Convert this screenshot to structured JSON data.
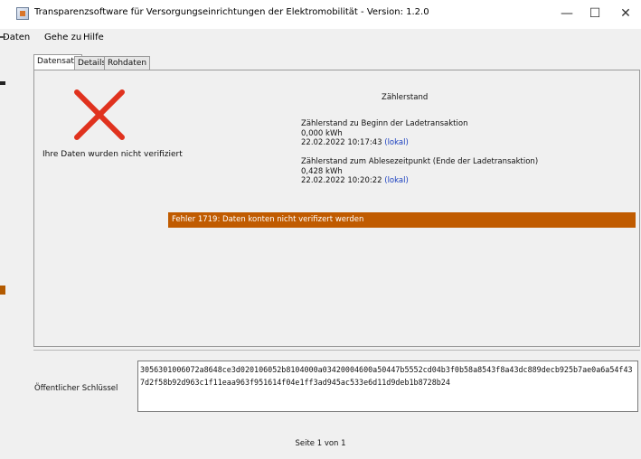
{
  "window": {
    "title": "Transparenzsoftware für Versorgungseinrichtungen der Elektromobilität - Version: 1.2.0",
    "controls": {
      "minimize": "—",
      "maximize": "☐",
      "close": "✕"
    }
  },
  "menu": {
    "items": [
      "Daten",
      "Gehe zu",
      "Hilfe"
    ]
  },
  "tabs": [
    "Datensatz",
    "Details",
    "Rohdaten"
  ],
  "status": {
    "message": "Ihre Daten wurden nicht verifiziert",
    "icon": "red-x-icon",
    "color": "#e0321e"
  },
  "meter": {
    "title": "Zählerstand",
    "start": {
      "label": "Zählerstand zu Beginn der Ladetransaktion",
      "value": "0,000 kWh",
      "timestamp": "22.02.2022 10:17:43",
      "tz_link": "(lokal)"
    },
    "end": {
      "label": "Zählerstand zum Ablesezeitpunkt (Ende der Ladetransaktion)",
      "value": "0,428 kWh",
      "timestamp": "22.02.2022 10:20:22",
      "tz_link": "(lokal)"
    }
  },
  "error": {
    "text": "Fehler 1719: Daten konten nicht verifizert werden",
    "color": "#c05b00"
  },
  "public_key": {
    "label": "Öffentlicher Schlüssel",
    "value": "3056301006072a8648ce3d020106052b8104000a03420004600a50447b5552cd04b3f0b58a8543f8a43dc889decb925b7ae0a6a54f437d2f58b92d963c1f11eaa963f951614f04e1ff3ad945ac533e6d11d9deb1b8728b24"
  },
  "footer": {
    "page": "Seite 1 von 1"
  }
}
